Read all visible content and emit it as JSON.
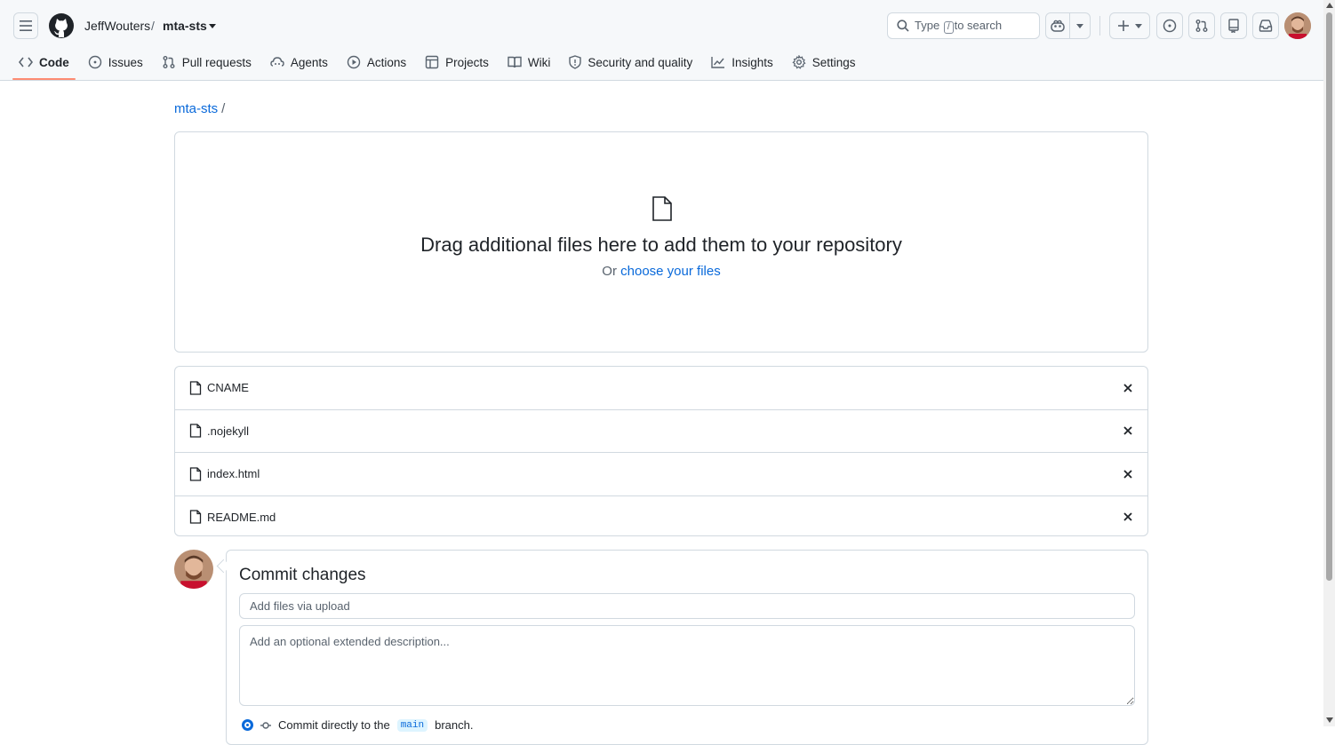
{
  "header": {
    "owner": "JeffWouters",
    "separator": "/",
    "repo": "mta-sts",
    "search": {
      "prefix": "Type",
      "key": "/",
      "suffix": "to search"
    }
  },
  "nav": {
    "tabs": [
      {
        "label": "Code",
        "icon": "code-icon",
        "active": true
      },
      {
        "label": "Issues",
        "icon": "issue-icon"
      },
      {
        "label": "Pull requests",
        "icon": "pull-request-icon"
      },
      {
        "label": "Agents",
        "icon": "agents-icon"
      },
      {
        "label": "Actions",
        "icon": "play-icon"
      },
      {
        "label": "Projects",
        "icon": "table-icon"
      },
      {
        "label": "Wiki",
        "icon": "book-icon"
      },
      {
        "label": "Security and quality",
        "icon": "shield-icon"
      },
      {
        "label": "Insights",
        "icon": "graph-icon"
      },
      {
        "label": "Settings",
        "icon": "gear-icon"
      }
    ]
  },
  "breadcrumb": {
    "repo": "mta-sts",
    "separator": "/"
  },
  "dropzone": {
    "title": "Drag additional files here to add them to your repository",
    "prefix": "Or",
    "link": "choose your files"
  },
  "files": [
    {
      "name": "CNAME"
    },
    {
      "name": ".nojekyll"
    },
    {
      "name": "index.html"
    },
    {
      "name": "README.md"
    }
  ],
  "commit": {
    "title": "Commit changes",
    "message_placeholder": "Add files via upload",
    "description_placeholder": "Add an optional extended description...",
    "option_prefix": "Commit directly to the",
    "branch": "main",
    "option_suffix": "branch."
  },
  "colors": {
    "accent": "#0969da",
    "active_tab_underline": "#fd8c73",
    "border": "#d1d9e0"
  }
}
